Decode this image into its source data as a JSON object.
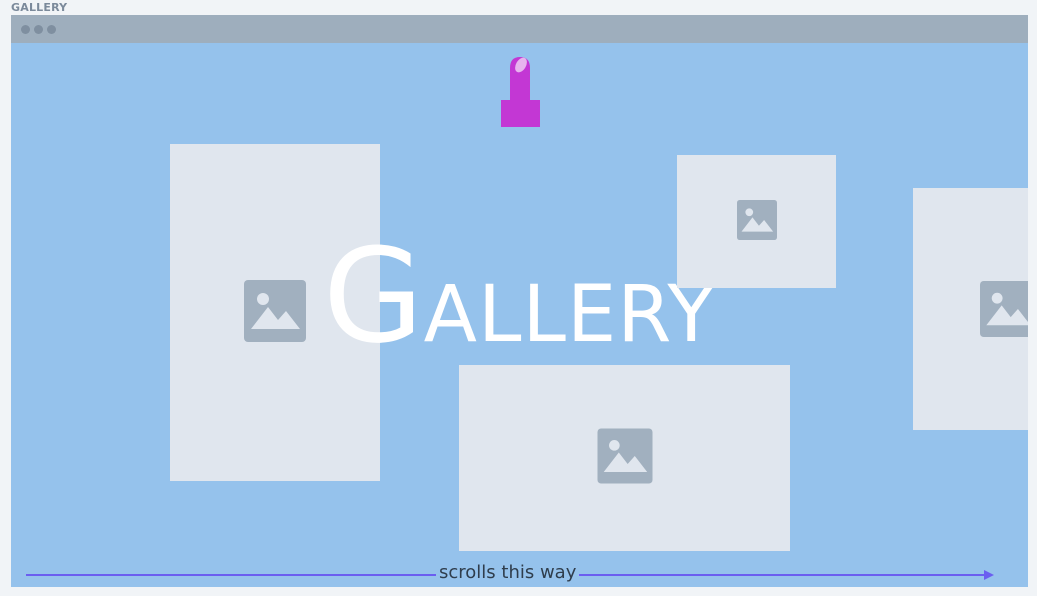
{
  "page": {
    "label": "GALLERY"
  },
  "window": {
    "controls": [
      "window-dot",
      "window-dot",
      "window-dot"
    ]
  },
  "hero": {
    "first_letter": "G",
    "rest": "ALLERY"
  },
  "images": [
    {
      "icon": "image-placeholder-icon"
    },
    {
      "icon": "image-placeholder-icon"
    },
    {
      "icon": "image-placeholder-icon"
    },
    {
      "icon": "image-placeholder-icon"
    }
  ],
  "decoration": {
    "icon": "lipstick-icon",
    "color": "#c337d4"
  },
  "scroll_hint": {
    "text": "scrolls this way",
    "color": "#6b5ef0"
  },
  "colors": {
    "canvas": "#95c2ec",
    "titlebar": "#9eaebd",
    "placeholder": "#e0e6ee",
    "placeholder_icon": "#a1b0bf"
  }
}
